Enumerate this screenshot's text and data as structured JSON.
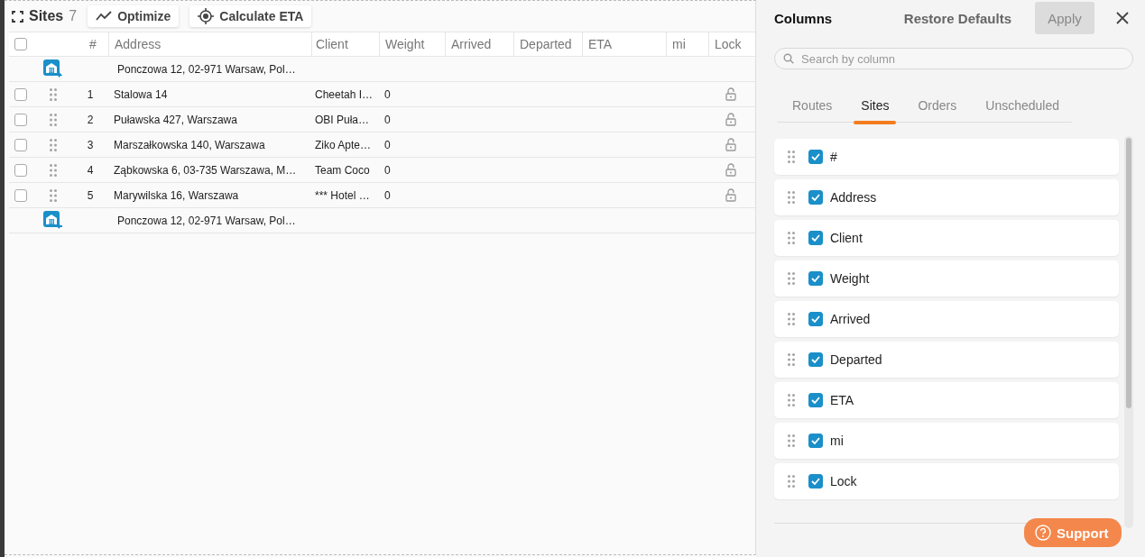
{
  "toolbar": {
    "title": "Sites",
    "count": "7",
    "buttons": [
      {
        "label": "Optimize",
        "kind": "optimize"
      },
      {
        "label": "Calculate ETA",
        "kind": "eta"
      }
    ]
  },
  "table": {
    "header_checked": false,
    "columns": [
      "#",
      "Address",
      "Client",
      "Weight",
      "Arrived",
      "Departed",
      "ETA",
      "mi",
      "Lock"
    ],
    "rows": [
      {
        "kind": "depot_out",
        "address": "Ponczowa 12, 02-971 Warsaw, Pol…"
      },
      {
        "kind": "stop",
        "checked": false,
        "number": "1",
        "address": "Stalowa 14",
        "client": "Cheetah I…",
        "weight": "0",
        "locked": false
      },
      {
        "kind": "stop",
        "checked": false,
        "number": "2",
        "address": "Puławska 427, Warszawa",
        "client": "OBI Puła…",
        "weight": "0",
        "locked": false
      },
      {
        "kind": "stop",
        "checked": false,
        "number": "3",
        "address": "Marszałkowska 140, Warszawa",
        "client": "Ziko Apte…",
        "weight": "0",
        "locked": false
      },
      {
        "kind": "stop",
        "checked": false,
        "number": "4",
        "address": "Ząbkowska 6, 03-735 Warszawa, M…",
        "client": "Team Coco",
        "weight": "0",
        "locked": false
      },
      {
        "kind": "stop",
        "checked": false,
        "number": "5",
        "address": "Marywilska 16, Warszawa",
        "client": "*** Hotel …",
        "weight": "0",
        "locked": false
      },
      {
        "kind": "depot_in",
        "address": "Ponczowa 12, 02-971 Warsaw, Pol…"
      }
    ]
  },
  "column_panel": {
    "title": "Columns",
    "restore_label": "Restore Defaults",
    "apply_label": "Apply",
    "apply_disabled": true,
    "search": {
      "placeholder": "Search by column"
    },
    "tabs": [
      {
        "label": "Routes",
        "selected": false
      },
      {
        "label": "Sites",
        "selected": true
      },
      {
        "label": "Orders",
        "selected": false
      },
      {
        "label": "Unscheduled",
        "selected": false
      }
    ],
    "items": [
      {
        "label": "#",
        "checked": true
      },
      {
        "label": "Address",
        "checked": true
      },
      {
        "label": "Client",
        "checked": true
      },
      {
        "label": "Weight",
        "checked": true
      },
      {
        "label": "Arrived",
        "checked": true
      },
      {
        "label": "Departed",
        "checked": true
      },
      {
        "label": "ETA",
        "checked": true
      },
      {
        "label": "mi",
        "checked": true
      },
      {
        "label": "Lock",
        "checked": true
      }
    ]
  },
  "support_button": {
    "label": "Support"
  }
}
